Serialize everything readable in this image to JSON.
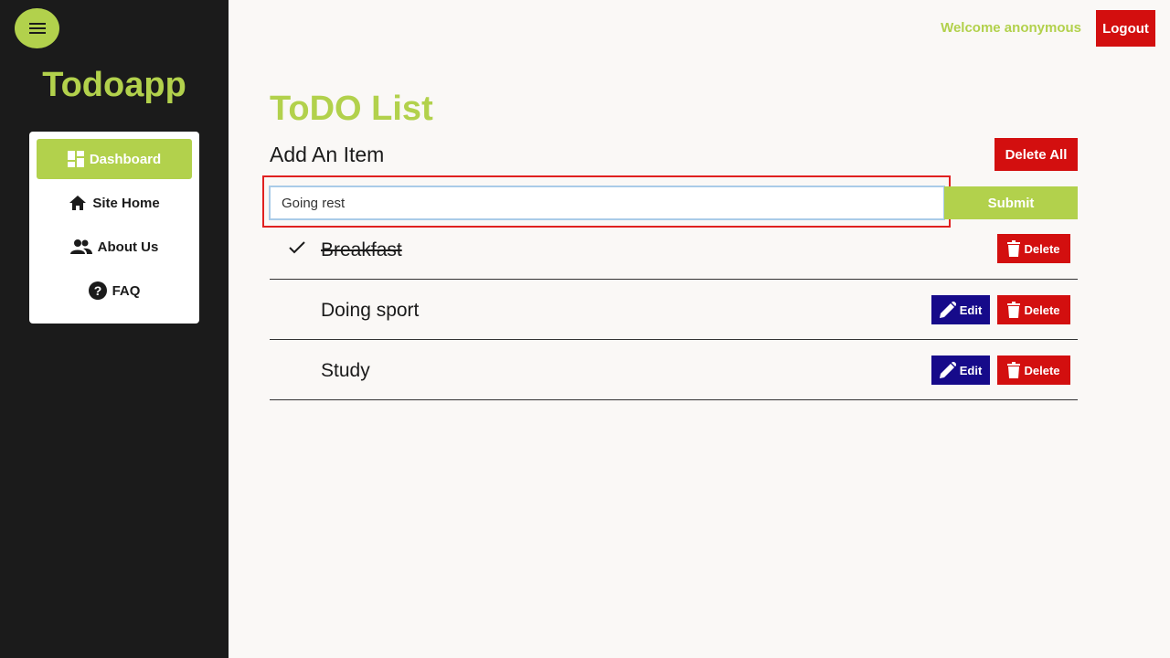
{
  "sidebar": {
    "brand": "Todoapp",
    "menu_icon": "hamburger-icon",
    "items": [
      {
        "label": "Dashboard",
        "icon": "dashboard-icon",
        "active": true
      },
      {
        "label": "Site Home",
        "icon": "home-icon",
        "active": false
      },
      {
        "label": "About Us",
        "icon": "people-icon",
        "active": false
      },
      {
        "label": "FAQ",
        "icon": "help-circle-icon",
        "active": false
      }
    ]
  },
  "header": {
    "welcome": "Welcome anonymous",
    "logout_label": "Logout"
  },
  "main": {
    "title": "ToDO List",
    "add_label": "Add An Item",
    "delete_all_label": "Delete All",
    "input_value": "Going rest",
    "submit_label": "Submit",
    "items": [
      {
        "text": "Breakfast",
        "done": true,
        "edit_label": "",
        "delete_label": "Delete"
      },
      {
        "text": "Doing sport",
        "done": false,
        "edit_label": "Edit",
        "delete_label": "Delete"
      },
      {
        "text": "Study",
        "done": false,
        "edit_label": "Edit",
        "delete_label": "Delete"
      }
    ]
  },
  "colors": {
    "accent": "#b2d14c",
    "danger": "#d30f0f",
    "edit": "#160a8a",
    "sidebar_bg": "#1b1b1b"
  }
}
